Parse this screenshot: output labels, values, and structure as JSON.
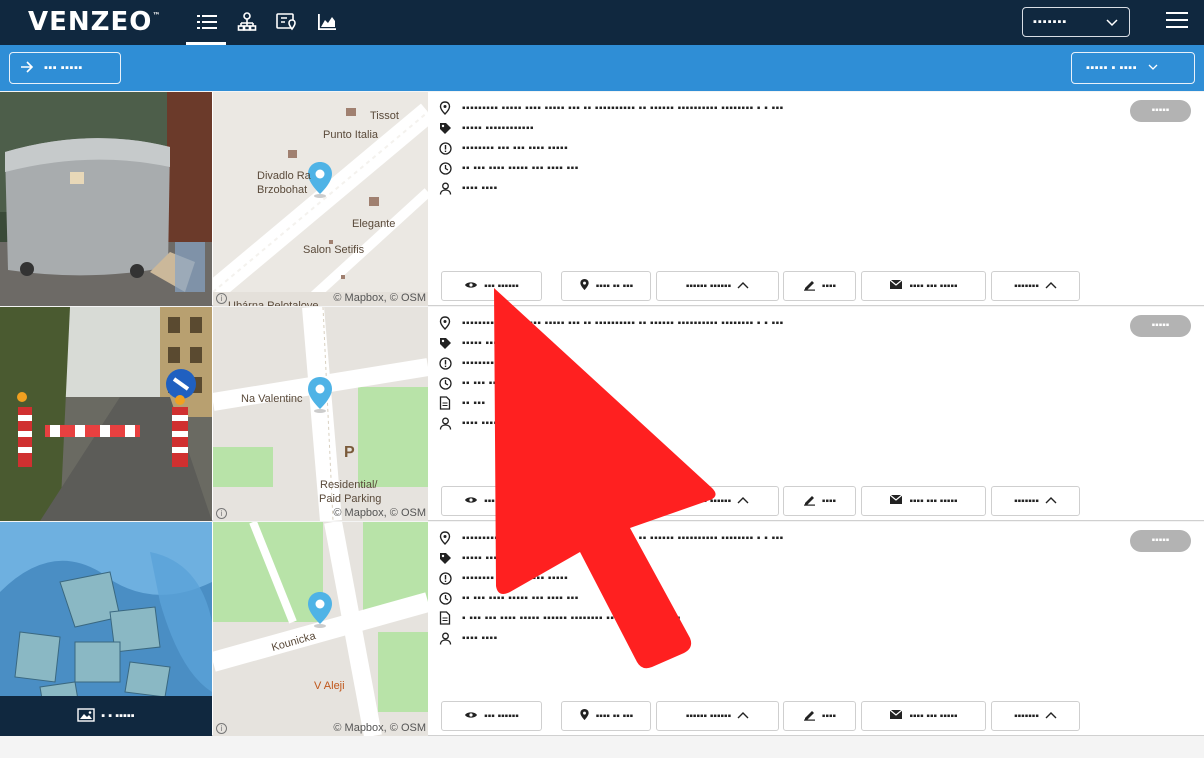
{
  "app": {
    "logo": "VENZEO",
    "logo_tm": "™"
  },
  "topbar": {
    "nav": [
      {
        "name": "list-view-icon",
        "active": true
      },
      {
        "name": "hierarchy-icon",
        "active": false
      },
      {
        "name": "map-pin-card-icon",
        "active": false
      },
      {
        "name": "chart-icon",
        "active": false
      }
    ],
    "select_value": "▪▪▪▪▪▪▪"
  },
  "subbar": {
    "left_button": "▪▪▪ ▪▪▪▪▪",
    "right_button": "▪▪▪▪▪ ▪ ▪▪▪▪"
  },
  "rows": [
    {
      "address": "▪▪▪▪▪▪▪▪▪ ▪▪▪▪▪ ▪▪▪▪ ▪▪▪▪▪ ▪▪▪ ▪▪ ▪▪▪▪▪▪▪▪▪▪ ▪▪ ▪▪▪▪▪▪ ▪▪▪▪▪▪▪▪▪▪ ▪▪▪▪▪▪▪▪ ▪ ▪ ▪▪▪",
      "category": "▪▪▪▪▪ ▪▪▪▪▪▪▪▪▪▪▪▪",
      "status_text": "▪▪▪▪▪▪▪▪ ▪▪▪ ▪▪▪ ▪▪▪▪ ▪▪▪▪▪",
      "time": "▪▪ ▪▪▪ ▪▪▪▪ ▪▪▪▪▪ ▪▪▪ ▪▪▪▪ ▪▪▪",
      "note": "",
      "user": "▪▪▪▪ ▪▪▪▪",
      "badge": "▪▪▪▪▪",
      "map_labels": [
        "Tissot",
        "Punto Italia",
        "Divadlo Ra",
        "Brzobohat",
        "Elegante",
        "Salon Setifis",
        "Ubárna Pelotalove"
      ],
      "map_credit": "© Mapbox, © OSM",
      "actions": {
        "view": "▪▪▪ ▪▪▪▪▪▪",
        "locate": "▪▪▪▪ ▪▪ ▪▪▪",
        "more": "▪▪▪▪▪▪ ▪▪▪▪▪▪",
        "edit": "▪▪▪▪",
        "mail": "▪▪▪▪ ▪▪▪ ▪▪▪▪▪",
        "options": "▪▪▪▪▪▪▪"
      },
      "photo_caption": ""
    },
    {
      "address": "▪▪▪▪▪▪▪▪▪ ▪▪▪▪▪ ▪▪▪▪ ▪▪▪▪▪ ▪▪▪ ▪▪ ▪▪▪▪▪▪▪▪▪▪ ▪▪ ▪▪▪▪▪▪ ▪▪▪▪▪▪▪▪▪▪ ▪▪▪▪▪▪▪▪ ▪ ▪ ▪▪▪",
      "category": "▪▪▪▪▪ ▪▪▪▪▪▪▪▪▪▪▪▪ ▪▪▪▪",
      "status_text": "▪▪▪▪▪▪▪▪ ▪▪▪ ▪▪▪ ▪▪▪▪ ▪▪▪▪▪",
      "time": "▪▪ ▪▪▪ ▪▪▪▪ ▪▪▪▪▪ ▪▪▪ ▪▪▪▪ ▪▪▪",
      "note": "▪▪ ▪▪▪",
      "user": "▪▪▪▪ ▪▪▪▪",
      "badge": "▪▪▪▪▪",
      "map_labels": [
        "Na Valentinc",
        "Residential/",
        "Paid Parking",
        "P"
      ],
      "map_credit": "© Mapbox, © OSM",
      "actions": {
        "view": "▪▪▪ ▪▪▪▪▪▪",
        "locate": "▪▪▪▪ ▪▪ ▪▪▪",
        "more": "▪▪▪▪▪▪ ▪▪▪▪▪▪",
        "edit": "▪▪▪▪",
        "mail": "▪▪▪▪ ▪▪▪ ▪▪▪▪▪",
        "options": "▪▪▪▪▪▪▪"
      },
      "photo_caption": ""
    },
    {
      "address": "▪▪▪▪▪▪▪▪▪ ▪▪▪▪▪ ▪▪▪▪ ▪▪▪▪▪ ▪▪▪ ▪▪ ▪▪▪▪▪▪▪▪▪▪ ▪▪ ▪▪▪▪▪▪ ▪▪▪▪▪▪▪▪▪▪ ▪▪▪▪▪▪▪▪ ▪ ▪ ▪▪▪",
      "category": "▪▪▪▪▪ ▪▪▪▪▪▪▪▪▪▪▪▪",
      "status_text": "▪▪▪▪▪▪▪▪ ▪▪▪ ▪▪▪ ▪▪▪▪ ▪▪▪▪▪",
      "time": "▪▪ ▪▪▪ ▪▪▪▪ ▪▪▪▪▪ ▪▪▪ ▪▪▪▪ ▪▪▪",
      "note": "▪ ▪▪▪ ▪▪▪ ▪▪▪▪ ▪▪▪▪▪ ▪▪▪▪▪▪ ▪▪▪▪▪▪▪▪ ▪▪▪▪▪▪▪▪ ▪▪▪▪ ▪▪▪ ▪",
      "user": "▪▪▪▪ ▪▪▪▪",
      "badge": "▪▪▪▪▪",
      "map_labels": [
        "Kounicka",
        "V Aleji"
      ],
      "map_credit": "© Mapbox, © OSM",
      "actions": {
        "view": "▪▪▪ ▪▪▪▪▪▪",
        "locate": "▪▪▪▪ ▪▪ ▪▪▪",
        "more": "▪▪▪▪▪▪ ▪▪▪▪▪▪",
        "edit": "▪▪▪▪",
        "mail": "▪▪▪▪ ▪▪▪ ▪▪▪▪▪",
        "options": "▪▪▪▪▪▪▪"
      },
      "photo_caption": "▪ ▪ ▪▪▪▪▪"
    }
  ],
  "colors": {
    "topbar": "#10283f",
    "subbar": "#2f8ed6",
    "pin": "#4fb3e6",
    "cursor": "#ff2020",
    "badge": "#b3b3b3"
  }
}
